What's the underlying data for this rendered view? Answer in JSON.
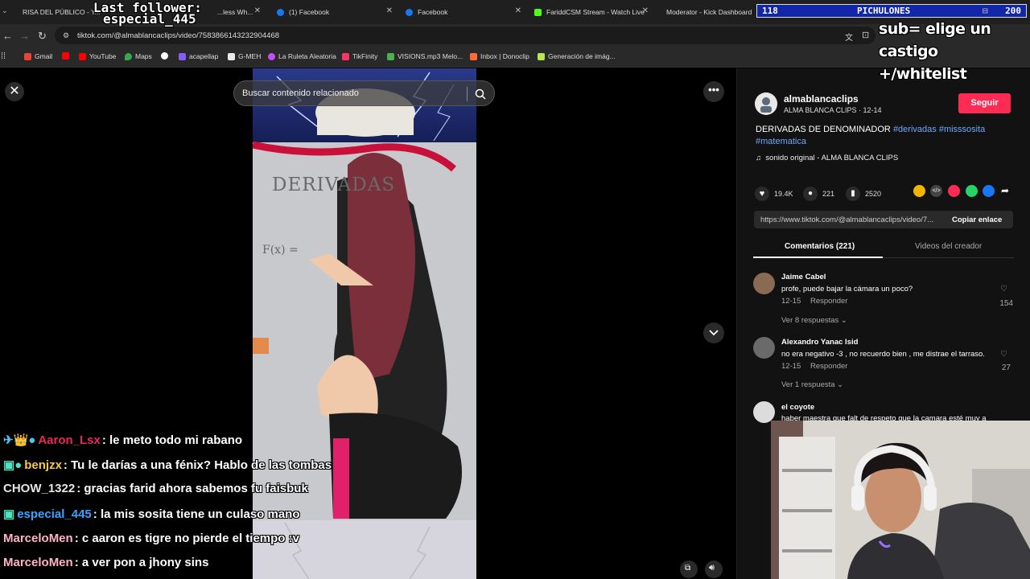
{
  "browser": {
    "tabs": [
      {
        "label": "RISA DEL PÚBLICO - Y...",
        "color": "#e1251b"
      },
      {
        "label": "...less Wh...",
        "color": "#999999"
      },
      {
        "label": "(1) Facebook",
        "color": "#1877f2"
      },
      {
        "label": "Facebook",
        "color": "#1877f2"
      },
      {
        "label": "FariddCSM Stream - Watch Live",
        "color": "#53fc18"
      },
      {
        "label": "Moderator - Kick Dashboard",
        "color": "#53fc18"
      }
    ],
    "url": "tiktok.com/@almablancaclips/video/7583866143232904468",
    "bookmarks": [
      {
        "label": "Gmail",
        "color": "#ea4335"
      },
      {
        "label": "YouTube",
        "color": "#ff0000"
      },
      {
        "label": "Maps",
        "color": "#34a853"
      },
      {
        "label": "",
        "color": "#ffffff"
      },
      {
        "label": "acapellap",
        "color": "#8a5cf6"
      },
      {
        "label": "G-MEH",
        "color": "#e8eaed"
      },
      {
        "label": "La Ruleta Aleatoria",
        "color": "#c44dff"
      },
      {
        "label": "TikFinity",
        "color": "#ff3366"
      },
      {
        "label": "VISIONS.mp3 Melo...",
        "color": "#4caf50"
      },
      {
        "label": "Inbox | Donoclip",
        "color": "#ff6b35"
      },
      {
        "label": "Generación de imág...",
        "color": "#b5e853"
      }
    ]
  },
  "overlay": {
    "last_follower_title": "Last follower:",
    "last_follower_name": "especial_445",
    "goal_current": "118",
    "goal_name": "PICHULONES",
    "goal_target": "200",
    "sub_note_line1": "sub= elige un castigo",
    "sub_note_line2": "+/whitelist"
  },
  "tiktok": {
    "search_placeholder": "Buscar contenido relacionado",
    "close_icon": "close-icon",
    "author": {
      "username": "almablancaclips",
      "meta": "ALMA BLANCA CLIPS · 12-14",
      "follow_label": "Seguir"
    },
    "description": "DERIVADAS DE DENOMINADOR",
    "hashtags": [
      "#derivadas",
      "#misssosita",
      "#matematica"
    ],
    "sound": "sonido original - ALMA BLANCA CLIPS",
    "stats": {
      "likes": "19.4K",
      "comments": "221",
      "saves": "2520"
    },
    "share_colors": [
      "#f4b400",
      "#444444",
      "#fe2c55",
      "#25d366",
      "#1877f2"
    ],
    "link": "https://www.tiktok.com/@almablancaclips/video/7...",
    "copy_label": "Copiar enlace",
    "tabs": {
      "comments": "Comentarios (221)",
      "creator": "Videos del creador"
    },
    "comments": [
      {
        "name": "Jaime Cabel",
        "text": "profe, puede bajar la cámara un poco?",
        "date": "12-15",
        "reply": "Responder",
        "likes": "154",
        "more": "Ver 8 respuestas"
      },
      {
        "name": "Alexandro Yanac Isid",
        "text": "no era negativo -3 , no recuerdo bien , me distrae el tarraso.",
        "date": "12-15",
        "reply": "Responder",
        "likes": "27",
        "more": "Ver 1 respuesta"
      },
      {
        "name": "el coyote",
        "text": "haber maestra que falt de respeto que la camara esté muy a",
        "date": "",
        "reply": "",
        "likes": "",
        "more": ""
      }
    ]
  },
  "video_board": {
    "title": "DERIVADAS",
    "formula": "F(x) ="
  },
  "chat": [
    {
      "user": "Aaron_Lsx",
      "color": "#e62a55",
      "badges": "✈👑●",
      "message": "le meto todo mi rabano"
    },
    {
      "user": "benjzx",
      "color": "#f7c948",
      "badges": "▣●",
      "message": "Tu le darías a una fénix? Hablo de las tombas"
    },
    {
      "user": "CHOW_1322",
      "color": "#e6e6e6",
      "badges": "",
      "message": "gracias farid ahora sabemos fu faisbuk"
    },
    {
      "user": "especial_445",
      "color": "#3aa3ff",
      "badges": "▣",
      "message": "la mis sosita tiene un culaso mano"
    },
    {
      "user": "MarceloMen",
      "color": "#ffb3c7",
      "badges": "",
      "message": "c aaron es tigre no pierde el tiempo :v"
    },
    {
      "user": "MarceloMen",
      "color": "#ffb3c7",
      "badges": "",
      "message": "a ver pon a jhony sins"
    }
  ]
}
